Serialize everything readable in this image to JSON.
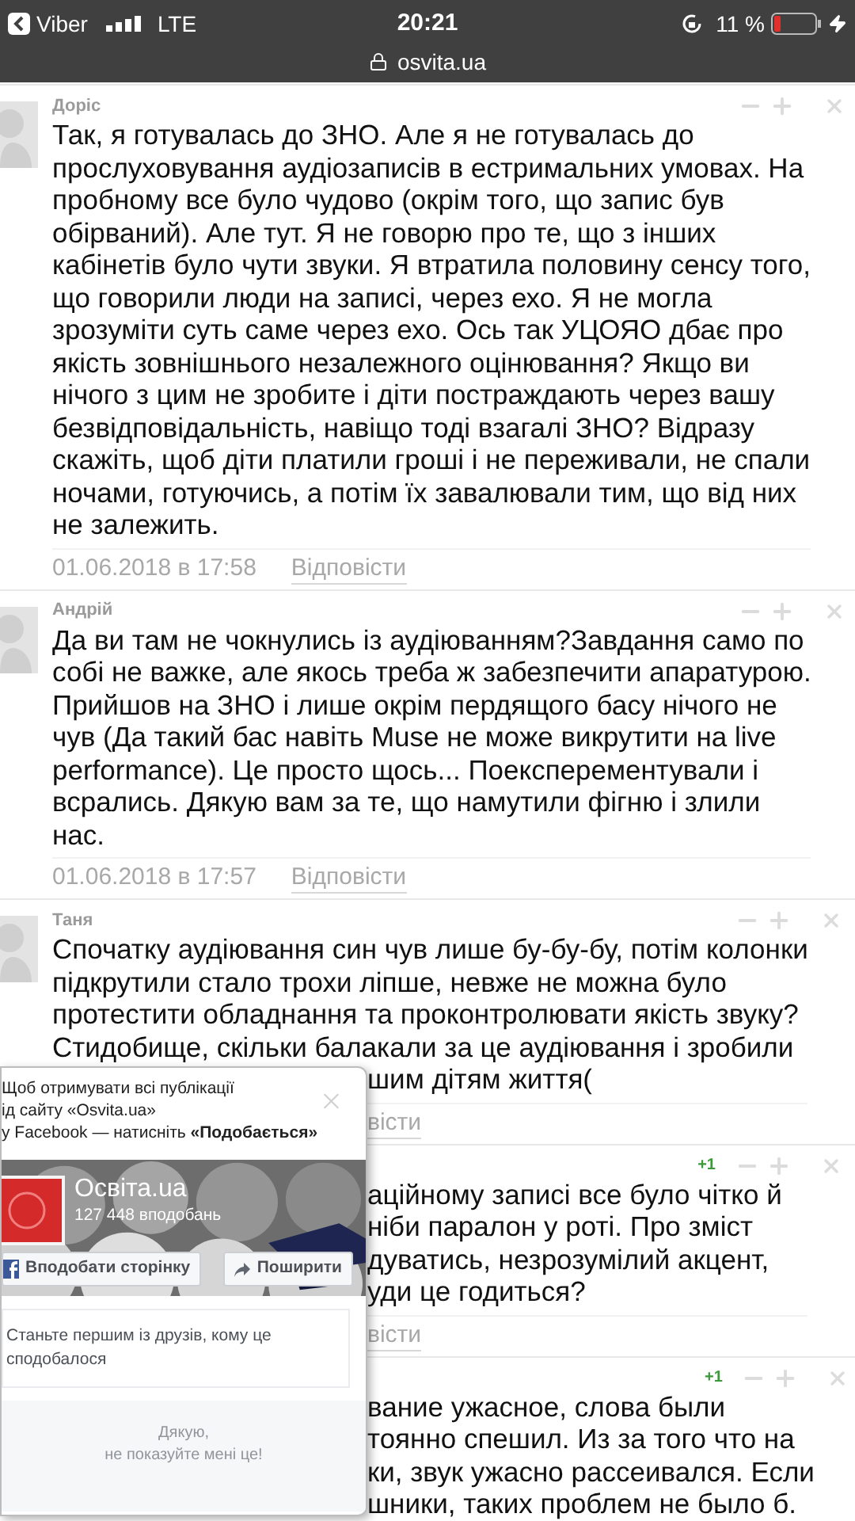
{
  "status_bar": {
    "back_app": "Viber",
    "carrier": "LTE",
    "time": "20:21",
    "battery": "11 %",
    "url": "osvita.ua"
  },
  "comments": [
    {
      "author": "Доріс",
      "avatar": true,
      "lines": [
        {
          "kind": "full",
          "text": "Так, я готувалась до ЗНО. Але я не готувалась до"
        },
        {
          "kind": "full",
          "text": "прослуховування аудіозаписів в естримальних умовах. На"
        },
        {
          "kind": "full",
          "text": "пробному все було чудово (окрім того, що запис був"
        },
        {
          "kind": "full",
          "text": "обірваний). Але тут. Я не говорю про те, що з інших"
        },
        {
          "kind": "full",
          "text": "кабінетів було чути звуки. Я втратила половину сенсу того,"
        },
        {
          "kind": "full",
          "text": "що говорили люди на записі, через ехо. Я не могла"
        },
        {
          "kind": "full",
          "text": "зрозуміти суть саме через ехо. Ось так УЦОЯО дбає про"
        },
        {
          "kind": "full",
          "text": "якість зовнішнього незалежного оцінювання? Якщо ви"
        },
        {
          "kind": "full",
          "text": "нічого з цим не зробите і діти постраждають через вашу"
        },
        {
          "kind": "full",
          "text": "безвідповідальність, навіщо тоді взагалі ЗНО? Відразу"
        },
        {
          "kind": "full",
          "text": "скажіть, щоб діти платили гроші і не переживали, не спали"
        },
        {
          "kind": "full",
          "text": "ночами, готуючись, а потім їх завалювали тим, що від них"
        },
        {
          "kind": "full",
          "text": "не залежить."
        }
      ],
      "date": "01.06.2018 в 17:58",
      "reply": {
        "kind": "full",
        "text": "Відповісти"
      }
    },
    {
      "author": "Андрій",
      "avatar": true,
      "lines": [
        {
          "kind": "full",
          "text": "Да ви там не чокнулись із аудіюванням?Завдання само по"
        },
        {
          "kind": "full",
          "text": "собі не важке, але якось треба ж забезпечити апаратурою."
        },
        {
          "kind": "full",
          "text": "Прийшов на ЗНО і лише окрім пердящого басу нічого не"
        },
        {
          "kind": "full",
          "text": "чув (Да такий бас навіть Muse не може викрутити на live"
        },
        {
          "kind": "full",
          "text": "performance). Це просто щось... Поексперементували і"
        },
        {
          "kind": "full",
          "text": "всрались. Дякую вам за те, що намутили фігню і злили"
        },
        {
          "kind": "full",
          "text": "нас."
        }
      ],
      "date": "01.06.2018 в 17:57",
      "reply": {
        "kind": "full",
        "text": "Відповісти"
      }
    },
    {
      "author": "Таня",
      "avatar": true,
      "lines": [
        {
          "kind": "full",
          "text": "Спочатку аудіювання син чув лише бу-бу-бу, потім колонки"
        },
        {
          "kind": "full",
          "text": "підкрутили стало трохи ліпше, невже не можна було"
        },
        {
          "kind": "full",
          "text": "протестити обладнання та проконтролювати якість звуку?"
        },
        {
          "kind": "full",
          "text": "Стидобище, скільки балакали за це аудіювання і зробили"
        },
        {
          "kind": "partial",
          "text": "шим дітям життя("
        }
      ],
      "reply": {
        "kind": "partial",
        "text": "вісти"
      }
    },
    {
      "rating": "+1",
      "lines": [
        {
          "kind": "partial",
          "text": "аційному записі все було чітко й"
        },
        {
          "kind": "partial",
          "text": "ніби паралон у роті. Про зміст"
        },
        {
          "kind": "partial",
          "text": "дуватись, незрозумілий акцент,"
        },
        {
          "kind": "partial",
          "text": "уди це годиться?"
        }
      ],
      "reply": {
        "kind": "partial",
        "text": "вісти"
      }
    },
    {
      "rating": "+1",
      "lines": [
        {
          "kind": "partial",
          "text": "вание ужасное, слова были"
        },
        {
          "kind": "partial",
          "text": "тоянно спешил. Из за того что на"
        },
        {
          "kind": "partial",
          "text": "ки, звук ужасно рассеивался. Если"
        },
        {
          "kind": "partial",
          "text": "шники, таких проблем не было б."
        }
      ]
    }
  ],
  "popup": {
    "intro": [
      "Щоб отримувати всі публікації",
      "ід сайту «Osvita.ua»",
      "у Facebook — натисніть **«Подобається»**"
    ],
    "page_name": "Освіта.ua",
    "likes": "127 448 вподобань",
    "like_button": "Вподобати сторінку",
    "share_button": "Поширити",
    "friends_note": "Станьте першим із друзів, кому це сподобалося",
    "dismiss": [
      "Дякую,",
      "не показуйте мені це!"
    ]
  }
}
